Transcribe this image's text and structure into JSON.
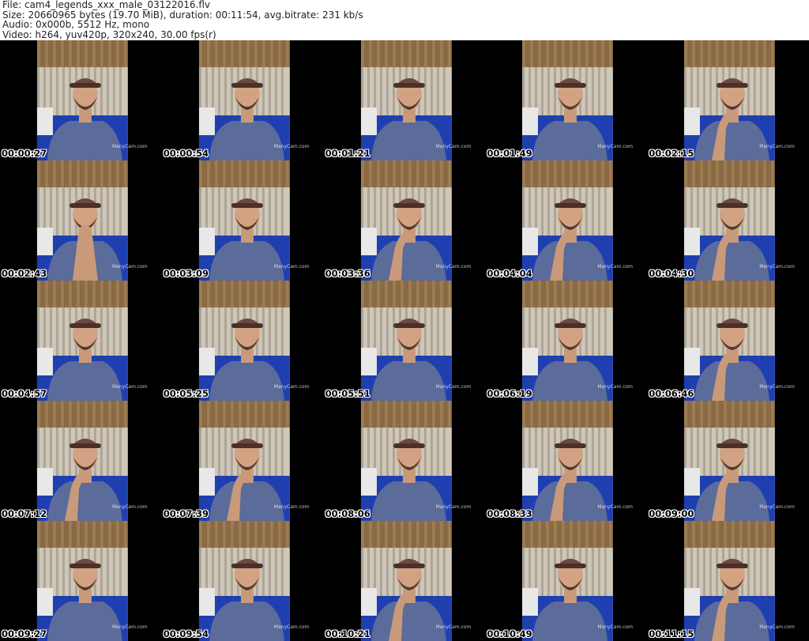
{
  "header": {
    "file_line": "File: cam4_legends_xxx_male_03122016.flv",
    "size_line": "Size: 20660965 bytes (19.70 MiB), duration: 00:11:54, avg.bitrate: 231 kb/s",
    "audio_line": "Audio: 0x000b, 5512 Hz, mono",
    "video_line": "Video: h264, yuv420p, 320x240, 30.00 fps(r)"
  },
  "watermark": "ManyCam.com",
  "thumbnails": [
    {
      "time": "00:00:27",
      "pose": "neutral"
    },
    {
      "time": "00:00:54",
      "pose": "neutral"
    },
    {
      "time": "00:01:21",
      "pose": "neutral"
    },
    {
      "time": "00:01:49",
      "pose": "neutral"
    },
    {
      "time": "00:02:15",
      "pose": "hand-chin"
    },
    {
      "time": "00:02:43",
      "pose": "hands-together"
    },
    {
      "time": "00:03:09",
      "pose": "neutral"
    },
    {
      "time": "00:03:36",
      "pose": "hand-chin"
    },
    {
      "time": "00:04:04",
      "pose": "hand-chin"
    },
    {
      "time": "00:04:30",
      "pose": "hand-chin"
    },
    {
      "time": "00:04:57",
      "pose": "neutral"
    },
    {
      "time": "00:05:25",
      "pose": "neutral"
    },
    {
      "time": "00:05:51",
      "pose": "neutral"
    },
    {
      "time": "00:06:19",
      "pose": "neutral"
    },
    {
      "time": "00:06:46",
      "pose": "hand-chin"
    },
    {
      "time": "00:07:12",
      "pose": "hand-chin"
    },
    {
      "time": "00:07:39",
      "pose": "hand-chin"
    },
    {
      "time": "00:08:06",
      "pose": "neutral"
    },
    {
      "time": "00:08:33",
      "pose": "hand-chin"
    },
    {
      "time": "00:09:00",
      "pose": "hand-chin"
    },
    {
      "time": "00:09:27",
      "pose": "neutral"
    },
    {
      "time": "00:09:54",
      "pose": "neutral"
    },
    {
      "time": "00:10:21",
      "pose": "hand-chin"
    },
    {
      "time": "00:10:49",
      "pose": "neutral"
    },
    {
      "time": "00:11:15",
      "pose": "hand-chin"
    }
  ]
}
